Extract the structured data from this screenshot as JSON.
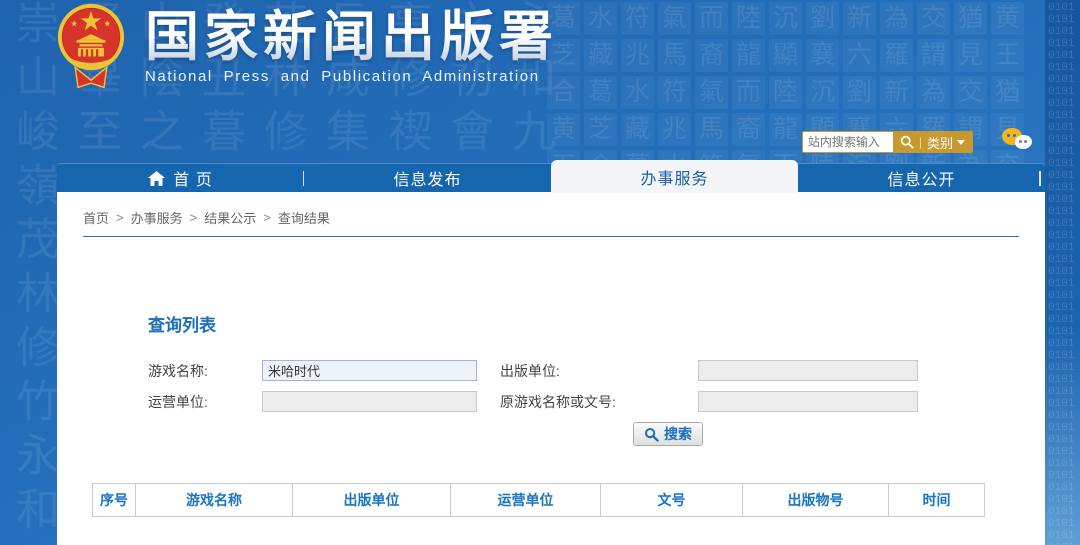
{
  "header": {
    "site_title": "国家新闻出版署",
    "site_subtitle": "National Press and Publication Administration",
    "search": {
      "placeholder": "站内搜索输入",
      "category_label": "类别"
    }
  },
  "nav": {
    "items": [
      {
        "label": "首 页"
      },
      {
        "label": "信息发布"
      },
      {
        "label": "办事服务",
        "active": true
      },
      {
        "label": "信息公开"
      }
    ]
  },
  "breadcrumb": {
    "separator": ">",
    "items": [
      "首页",
      "办事服务",
      "结果公示",
      "查询结果"
    ]
  },
  "main": {
    "section_title": "查询列表",
    "form": {
      "game_name": {
        "label": "游戏名称:",
        "value": "米哈时代"
      },
      "publisher": {
        "label": "出版单位:",
        "value": ""
      },
      "operator": {
        "label": "运营单位:",
        "value": ""
      },
      "original_doc": {
        "label": "原游戏名称或文号:",
        "value": ""
      },
      "search_button_label": "搜索"
    },
    "table": {
      "headers": [
        "序号",
        "游戏名称",
        "出版单位",
        "运营单位",
        "文号",
        "出版物号",
        "时间"
      ],
      "rows": []
    }
  },
  "colors": {
    "header_blue": "#2471bd",
    "nav_blue": "#1565af",
    "accent_blue": "#1a6ebc",
    "gold": "#c8992e",
    "emblem_red": "#d6342a",
    "emblem_gold": "#eec435"
  },
  "decor": {
    "calligraphy_chars": "永和九年歲在癸丑暮春之初會于會稽山陰之蘭亭修禊事也群賢畢至少長咸集此地有崇山峻嶺茂林修竹",
    "seal_chars": "葛水符氣而陸沉劉新為交猶黄芝藏兆馬裔龍顯襄六羅謂見王合",
    "binary_chars": "01"
  }
}
